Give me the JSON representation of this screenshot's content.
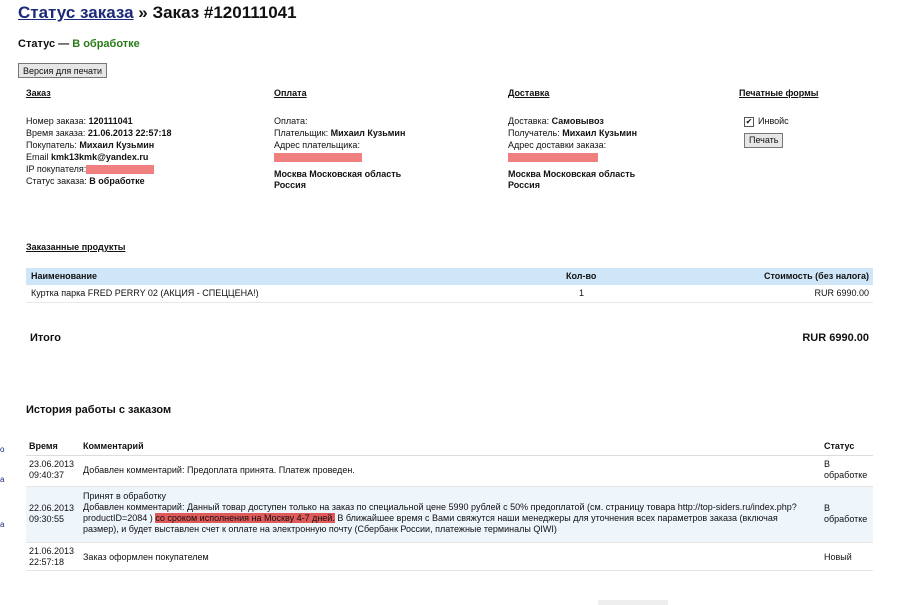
{
  "header": {
    "link": "Статус заказа",
    "sep": " » ",
    "title": "Заказ #120111041"
  },
  "status": {
    "label": "Статус — ",
    "value": "В обработке"
  },
  "print_button": "Версия для печати",
  "order": {
    "title": "Заказ",
    "number_label": "Номер заказа:",
    "number": "120111041",
    "time_label": "Время заказа:",
    "time": "21.06.2013 22:57:18",
    "buyer_label": "Покупатель:",
    "buyer": "Михаил Кузьмин",
    "email_label": "Email",
    "email": "kmk13kmk@yandex.ru",
    "ip_label": "IP покупателя:",
    "status_label": "Статус заказа:",
    "status": "В обработке"
  },
  "payment": {
    "title": "Оплата",
    "pay_label": "Оплата:",
    "payer_label": "Плательщик:",
    "payer": "Михаил Кузьмин",
    "addr_label": "Адрес плательщика:",
    "addr_line1": "Москва Московская область",
    "addr_line2": "Россия"
  },
  "delivery": {
    "title": "Доставка",
    "method_label": "Доставка:",
    "method": "Самовывоз",
    "recipient_label": "Получатель:",
    "recipient": "Михаил Кузьмин",
    "addr_label": "Адрес доставки заказа:",
    "addr_line1": "Москва Московская область",
    "addr_line2": "Россия"
  },
  "forms": {
    "title": "Печатные формы",
    "checkbox_label": "Инвойс",
    "print_label": "Печать"
  },
  "products": {
    "title": "Заказанные продукты",
    "headers": {
      "name": "Наименование",
      "qty": "Кол-во",
      "price": "Стоимость (без налога)"
    },
    "rows": [
      {
        "name": "Куртка парка FRED PERRY 02 (АКЦИЯ - СПЕЦЦЕНА!)",
        "qty": "1",
        "price": "RUR 6990.00"
      }
    ],
    "total_label": "Итого",
    "total_value": "RUR 6990.00"
  },
  "history": {
    "title": "История работы с заказом",
    "headers": {
      "time": "Время",
      "comment": "Комментарий",
      "status": "Статус"
    },
    "rows": [
      {
        "date": "23.06.2013",
        "time": "09:40:37",
        "comment": "Добавлен комментарий: Предоплата принята. Платеж проведен.",
        "status1": "В",
        "status2": "обработке"
      },
      {
        "date": "22.06.2013",
        "time": "09:30:55",
        "line0": "Принят в обработку",
        "line1": "Добавлен комментарий: Данный товар доступен только на заказ по специальной цене 5990 рублей с 50% предоплатой (см. страницу товара http://top-siders.ru/index.php?",
        "line2a": "productID=2084 )",
        "line2hl": "со сроком исполнения на Москву 4-7 дней.",
        "line2b": "В ближайшее время с Вами свяжутся наши менеджеры для уточнения всех параметров заказа (включая",
        "line3": "размер), и будет выставлен счет к оплате на электронную почту (Сбербанк России, платежные терминалы QIWI)",
        "status1": "В",
        "status2": "обработке"
      },
      {
        "date": "21.06.2013",
        "time": "22:57:18",
        "comment": "Заказ оформлен покупателем",
        "status": "Новый"
      }
    ]
  },
  "edge_glyphs": [
    "о",
    "а",
    "а"
  ],
  "colors": {
    "accent_green": "#2a7a1a",
    "link_blue": "#1b2a7a",
    "table_header": "#cfe6f8",
    "highlight_red": "#e05a5a",
    "redaction": "#f08080"
  }
}
